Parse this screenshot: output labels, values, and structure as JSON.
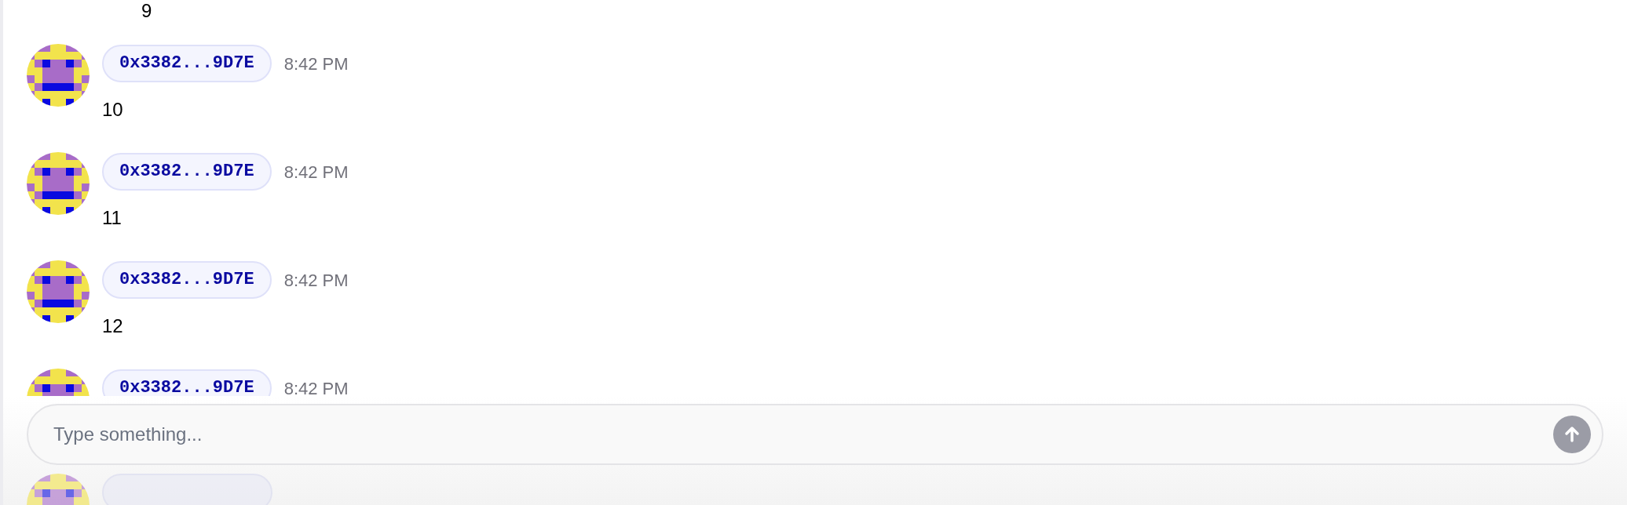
{
  "messages": [
    {
      "text": "9"
    },
    {
      "address": "0x3382...9D7E",
      "time": "8:42 PM",
      "text": "10"
    },
    {
      "address": "0x3382...9D7E",
      "time": "8:42 PM",
      "text": "11"
    },
    {
      "address": "0x3382...9D7E",
      "time": "8:42 PM",
      "text": "12"
    },
    {
      "address": "0x3382...9D7E",
      "time": "8:42 PM"
    }
  ],
  "composer": {
    "placeholder": "Type something..."
  }
}
